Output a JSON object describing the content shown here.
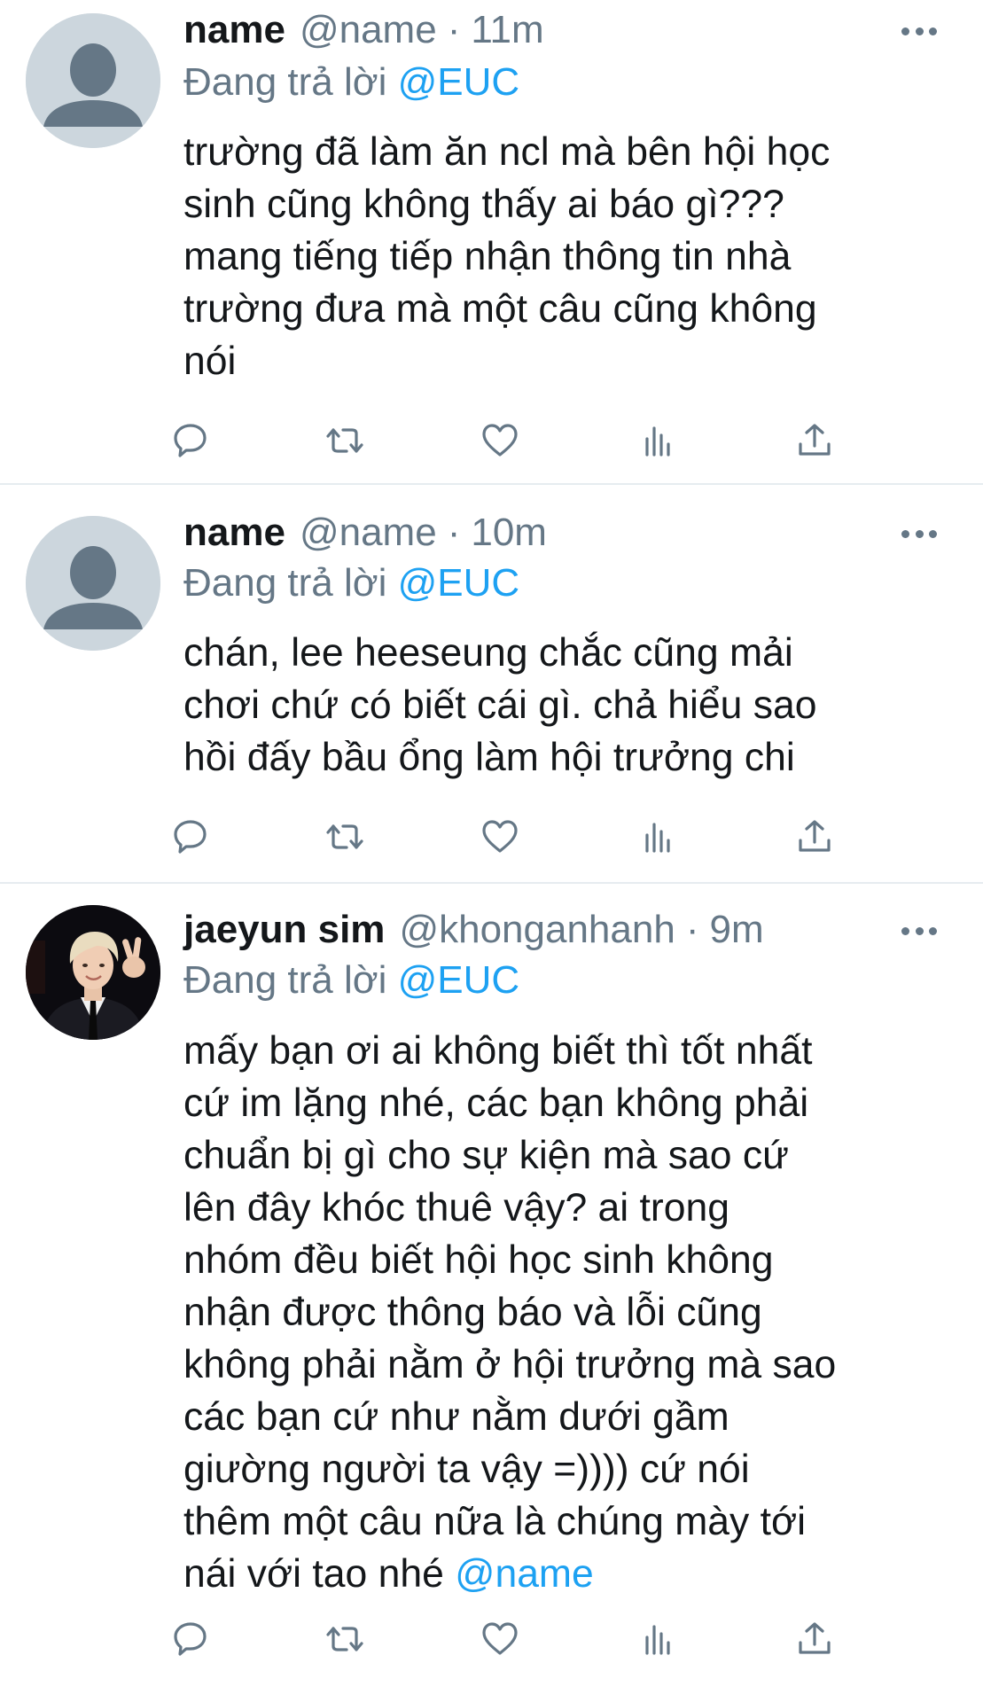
{
  "tweets": [
    {
      "display_name": "name",
      "handle": "@name",
      "dot": "·",
      "time": "11m",
      "reply_prefix": "Đang trả lời",
      "reply_to": "@EUC",
      "text": "trường đã làm ăn ncl mà bên hội học\nsinh cũng không thấy ai báo gì???\nmang tiếng tiếp nhận thông tin nhà\ntrường đưa mà một câu cũng không\nnói",
      "text_mention": "",
      "avatar": "default-profile-avatar"
    },
    {
      "display_name": "name",
      "handle": "@name",
      "dot": "·",
      "time": "10m",
      "reply_prefix": "Đang trả lời",
      "reply_to": "@EUC",
      "text": "chán, lee heeseung chắc cũng mải\nchơi chứ có biết cái gì. chả hiểu sao\nhồi đấy bầu ổng làm hội trưởng chi",
      "text_mention": "",
      "avatar": "default-profile-avatar"
    },
    {
      "display_name": "jaeyun sim",
      "handle": "@khonganhanh",
      "dot": "·",
      "time": "9m",
      "reply_prefix": "Đang trả lời",
      "reply_to": "@EUC",
      "text": "mấy bạn ơi ai không biết thì tốt nhất\ncứ im lặng nhé, các bạn không phải\nchuẩn bị gì cho sự kiện mà sao cứ\nlên đây khóc thuê vậy? ai trong\nnhóm đều biết hội học sinh không\nnhận được thông báo và lỗi cũng\nkhông phải nằm ở hội trưởng mà sao\ncác bạn cứ như nằm dưới gầm\ngiường người ta vậy =)))) cứ nói\nthêm một câu nữa là chúng mày tới\nnái với tao nhé ",
      "text_mention": "@name",
      "avatar": "photo-avatar"
    }
  ],
  "actions": [
    "reply-icon",
    "retweet-icon",
    "like-icon",
    "analytics-icon",
    "share-icon"
  ],
  "colors": {
    "mention": "#1da1f2",
    "secondary": "#657786",
    "divider": "#e6ecf0",
    "avatar_placeholder": "#ccd6dd"
  }
}
